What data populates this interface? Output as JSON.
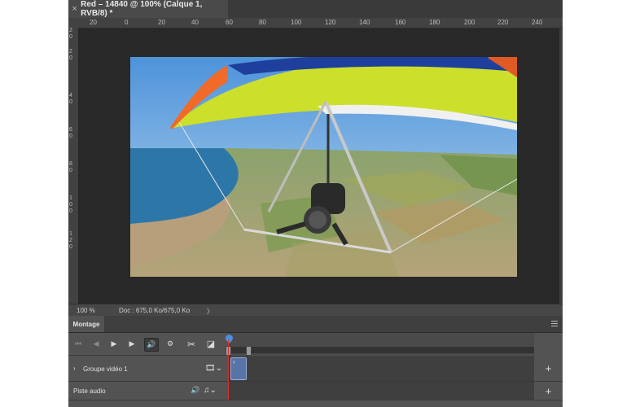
{
  "document": {
    "tab_title": "Red – 14840 @ 100% (Calque 1, RVB/8) *",
    "close_glyph": "×"
  },
  "ruler": {
    "top_labels": [
      "20",
      "0",
      "20",
      "40",
      "60",
      "80",
      "100",
      "120",
      "140",
      "160",
      "180",
      "200",
      "220",
      "240"
    ],
    "left_labels": [
      "2",
      "0",
      "2",
      "0",
      "4",
      "0",
      "6",
      "0",
      "8",
      "0",
      "1",
      "0",
      "0",
      "1",
      "2",
      "0"
    ]
  },
  "status": {
    "zoom": "100 %",
    "doc_info": "Doc : 675,0 Ko/675,0 Ko",
    "arrow": "〉"
  },
  "timeline": {
    "panel_title": "Montage",
    "controls": {
      "first_frame": "⏮",
      "prev_frame": "◀",
      "play": "▶",
      "next_frame": "▶",
      "audio": "🔊",
      "settings": "⚙",
      "split": "✂",
      "transition": "◪"
    },
    "tracks": [
      {
        "name": "Groupe vidéo 1",
        "chevron": "›",
        "add": "+"
      },
      {
        "name": "Piste audio",
        "add": "+"
      }
    ]
  },
  "colors": {
    "app_bg": "#535353",
    "canvas_bg": "#282828",
    "playhead": "#4a90e2",
    "clip": "#5874a7"
  },
  "icons": [
    "close-icon",
    "first-frame-icon",
    "prev-frame-icon",
    "play-icon",
    "next-frame-icon",
    "audio-icon",
    "gear-icon",
    "scissors-icon",
    "transition-icon",
    "film-icon",
    "music-note-icon",
    "plus-icon",
    "panel-menu-icon"
  ]
}
